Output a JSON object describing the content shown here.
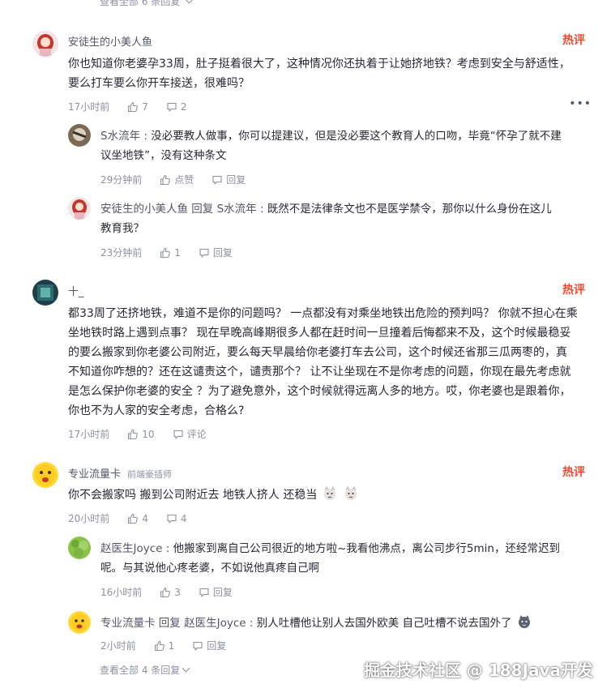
{
  "top_more": "查看全部 6 条回复",
  "c1": {
    "author": "安徒生的小美人鱼",
    "text1": "你也知道你老婆孕33周，肚子挺着很大了，这种情况你还执着于让她挤地铁？考虑到安全与舒适性，",
    "text2": "要么打车要么你开车接送，很难吗？",
    "time": "17小时前",
    "likes": "7",
    "comments": "2",
    "hot_label": "热评"
  },
  "c1r1": {
    "author": "S水流年",
    "text1": "没必要教人做事，你可以提建议，但是没必要这个教育人的口吻，毕竟“怀孕了就不建",
    "text2": "议坐地铁”，没有这种条文",
    "time": "29分钟前",
    "like_label": "点赞",
    "reply_label": "回复"
  },
  "c1r2": {
    "author": "安徒生的小美人鱼",
    "reply_word": "回复",
    "target": "S水流年",
    "text1": "既然不是法律条文也不是医学禁令，那你以什么身份在这儿",
    "text2": "教育我？",
    "time": "23分钟前",
    "likes": "1",
    "reply_label": "回复"
  },
  "c2": {
    "author": "十_",
    "text1": "都33周了还挤地铁，难道不是你的问题吗？ 一点都没有对乘坐地铁出危险的预判吗？ 你就不担心在乘",
    "text2": "坐地铁时路上遇到点事？ 现在早晚高峰期很多人都在赶时间一旦撞着后悔都来不及，这个时候最稳妥",
    "text3": "的要么搬家到你老婆公司附近，要么每天早晨给你老婆打车去公司，这个时候还省那三瓜两枣的，真",
    "text4": "不知道你咋想的？还在这谴责这个，谴责那个？ 让不让坐现在不是你考虑的问题，你现在最先考虑就",
    "text5": "是怎么保护你老婆的安全 ？为了避免意外，这个时候就得远离人多的地方。哎，你老婆也是跟着你，",
    "text6": "你也不为人家的安全考虑，合格么?",
    "time": "17小时前",
    "likes": "10",
    "comment_label": "评论",
    "hot_label": "热评"
  },
  "c3": {
    "author": "专业流量卡",
    "tag": "前端豪插师",
    "text": "你不会搬家吗 搬到公司附近去 地铁人挤人 还稳当",
    "time": "20小时前",
    "likes": "4",
    "comments": "4",
    "hot_label": "热评"
  },
  "c3r1": {
    "author": "赵医生Joyce",
    "text1": "他搬家到离自己公司很近的地方啦~我看他沸点，离公司步行5min，还经常迟到",
    "text2": "呢。与其说他心疼老婆，不如说他真疼自己啊",
    "time": "16小时前",
    "likes": "3",
    "reply_label": "回复"
  },
  "c3r2": {
    "author": "专业流量卡",
    "reply_word": "回复",
    "target": "赵医生Joyce",
    "text": "别人吐槽他让别人去国外欧美 自己吐槽不说去国外了",
    "time": "2小时前",
    "likes": "1",
    "reply_label": "回复"
  },
  "bottom_more": "查看全部 4 条回复",
  "watermark": "掘金技术社区 @ 188Java开发",
  "colors": {
    "hot": "#f2472e",
    "text": "#252933",
    "muted": "#8a919f"
  },
  "icons": [
    "chevron-down-icon",
    "like-icon",
    "comment-icon",
    "more-dots-icon",
    "hot-badge-icon",
    "cat-emoji-icon"
  ]
}
